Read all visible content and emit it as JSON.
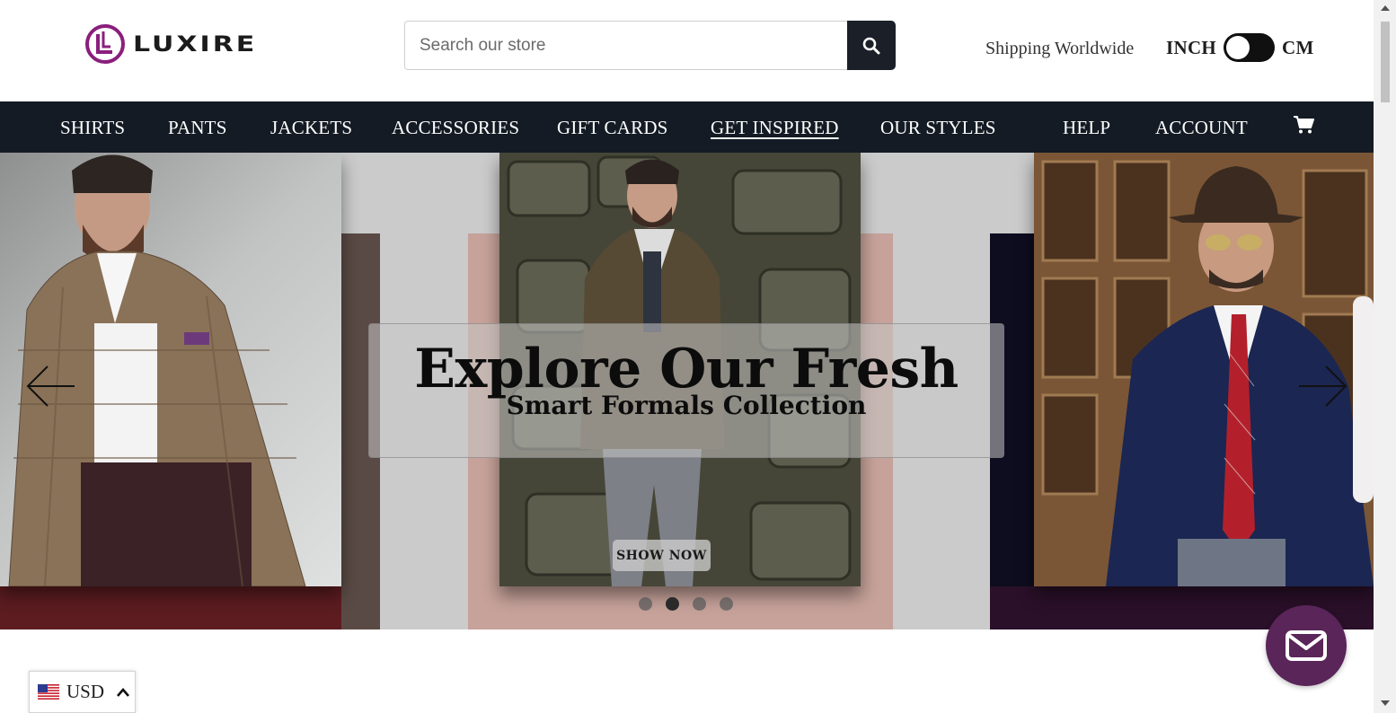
{
  "header": {
    "logo_text": "LUXIRE",
    "search": {
      "placeholder": "Search our store",
      "value": ""
    },
    "shipping_text": "Shipping Worldwide",
    "units": {
      "left": "INCH",
      "right": "CM",
      "selected": "INCH"
    }
  },
  "nav": {
    "items": [
      {
        "label": "SHIRTS"
      },
      {
        "label": "PANTS"
      },
      {
        "label": "JACKETS"
      },
      {
        "label": "ACCESSORIES"
      },
      {
        "label": "GIFT CARDS"
      },
      {
        "label": "GET INSPIRED",
        "active": true
      },
      {
        "label": "OUR STYLES"
      },
      {
        "label": "HELP"
      },
      {
        "label": "ACCOUNT"
      }
    ],
    "cart_icon": "cart-icon"
  },
  "hero": {
    "title": "Explore Our Fresh",
    "subtitle": "Smart Formals Collection",
    "cta": "SHOW NOW",
    "slides_count": 4,
    "active_slide": 2
  },
  "currency": {
    "code": "USD",
    "flag": "us-flag-icon"
  },
  "colors": {
    "nav_bg": "#141b24",
    "search_button": "#1b1f27",
    "brand_purple": "#8a1f7d",
    "chat_bg": "#5a2559",
    "hero_bg": "#cbcbcb"
  }
}
